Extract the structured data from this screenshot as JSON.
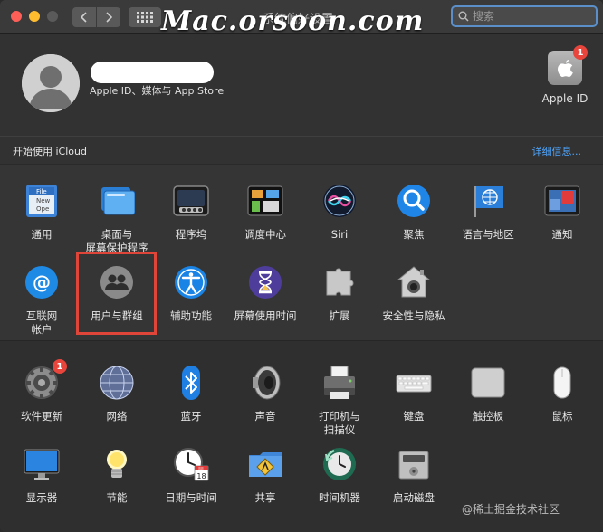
{
  "window": {
    "title": "系统偏好设置",
    "watermark": "Mac.orsoon.com",
    "search": {
      "placeholder": "搜索"
    }
  },
  "account": {
    "subtitle": "Apple ID、媒体与 App Store",
    "apple_id": {
      "label": "Apple ID",
      "badge": "1"
    }
  },
  "icloud": {
    "prompt": "开始使用 iCloud",
    "details_link": "详细信息..."
  },
  "section1": {
    "row1": [
      {
        "label": "通用",
        "icon": "general-icon"
      },
      {
        "label": "桌面与\n屏幕保护程序",
        "icon": "desktop-screensaver-icon"
      },
      {
        "label": "程序坞",
        "icon": "dock-icon"
      },
      {
        "label": "调度中心",
        "icon": "mission-control-icon"
      },
      {
        "label": "Siri",
        "icon": "siri-icon"
      },
      {
        "label": "聚焦",
        "icon": "spotlight-icon"
      },
      {
        "label": "语言与地区",
        "icon": "language-region-icon"
      },
      {
        "label": "通知",
        "icon": "notifications-icon"
      }
    ],
    "row2": [
      {
        "label": "互联网\n帐户",
        "icon": "internet-accounts-icon"
      },
      {
        "label": "用户与群组",
        "icon": "users-groups-icon"
      },
      {
        "label": "辅助功能",
        "icon": "accessibility-icon"
      },
      {
        "label": "屏幕使用时间",
        "icon": "screen-time-icon"
      },
      {
        "label": "扩展",
        "icon": "extensions-icon"
      },
      {
        "label": "安全性与隐私",
        "icon": "security-privacy-icon"
      }
    ]
  },
  "section2": {
    "row1": [
      {
        "label": "软件更新",
        "icon": "software-update-icon",
        "badge": "1"
      },
      {
        "label": "网络",
        "icon": "network-icon"
      },
      {
        "label": "蓝牙",
        "icon": "bluetooth-icon"
      },
      {
        "label": "声音",
        "icon": "sound-icon"
      },
      {
        "label": "打印机与\n扫描仪",
        "icon": "printers-scanners-icon"
      },
      {
        "label": "键盘",
        "icon": "keyboard-icon"
      },
      {
        "label": "触控板",
        "icon": "trackpad-icon"
      },
      {
        "label": "鼠标",
        "icon": "mouse-icon"
      }
    ],
    "row2": [
      {
        "label": "显示器",
        "icon": "displays-icon"
      },
      {
        "label": "节能",
        "icon": "energy-saver-icon"
      },
      {
        "label": "日期与时间",
        "icon": "date-time-icon",
        "calendar_day": "18",
        "calendar_month": "JUL"
      },
      {
        "label": "共享",
        "icon": "sharing-icon"
      },
      {
        "label": "时间机器",
        "icon": "time-machine-icon"
      },
      {
        "label": "启动磁盘",
        "icon": "startup-disk-icon"
      }
    ]
  },
  "footer_watermark": "@稀土掘金技术社区",
  "colors": {
    "highlight": "#e0453a",
    "link": "#4fa6ff",
    "badge": "#e8453c"
  }
}
